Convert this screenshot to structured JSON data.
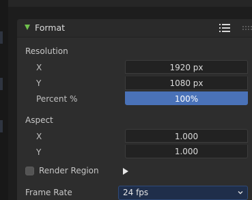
{
  "panel": {
    "title": "Format"
  },
  "resolution": {
    "label": "Resolution",
    "x_label": "X",
    "x_value": "1920 px",
    "y_label": "Y",
    "y_value": "1080 px",
    "percent_label": "Percent %",
    "percent_value": "100%"
  },
  "aspect": {
    "label": "Aspect",
    "x_label": "X",
    "x_value": "1.000",
    "y_label": "Y",
    "y_value": "1.000"
  },
  "render_region": {
    "label": "Render Region",
    "checked": false
  },
  "frame_rate": {
    "label": "Frame Rate",
    "value": "24 fps"
  },
  "colors": {
    "accent_blue": "#4a72b8",
    "expand_triangle": "#70c24d"
  },
  "icons": {
    "collapse": "triangle-down-icon",
    "presets": "list-icon",
    "drag": "drag-handle-icon",
    "expand": "play-icon",
    "dropdown": "chevron-down-icon"
  }
}
